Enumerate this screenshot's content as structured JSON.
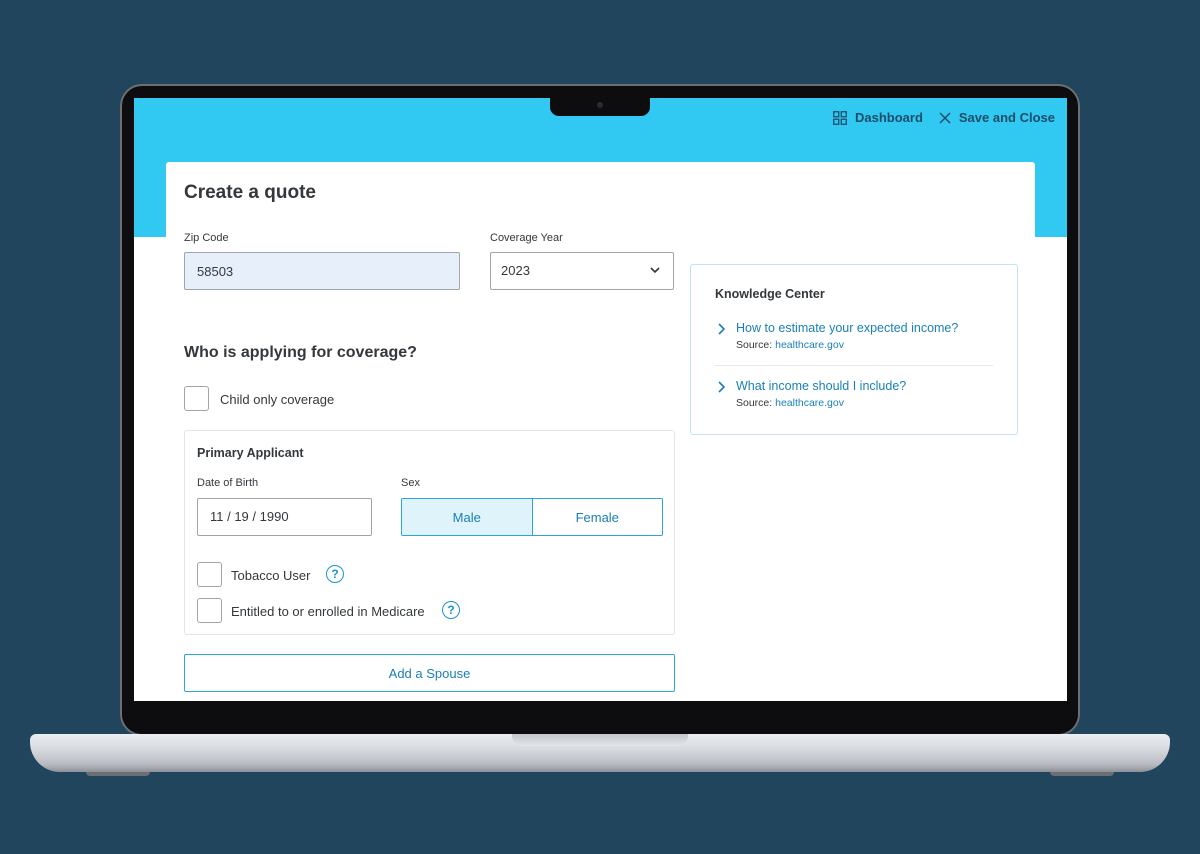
{
  "header": {
    "dashboard_label": "Dashboard",
    "save_close_label": "Save and Close"
  },
  "page": {
    "title": "Create a quote"
  },
  "zip": {
    "label": "Zip Code",
    "value": "58503"
  },
  "coverage_year": {
    "label": "Coverage Year",
    "selected": "2023"
  },
  "applying": {
    "title": "Who is applying for coverage?",
    "child_only_label": "Child only coverage"
  },
  "primary_applicant": {
    "title": "Primary Applicant",
    "dob_label": "Date of Birth",
    "dob_value": "11 / 19 / 1990",
    "sex_label": "Sex",
    "sex_options": [
      "Male",
      "Female"
    ],
    "sex_selected": "Male",
    "tobacco_label": "Tobacco User",
    "medicare_label": "Entitled to or enrolled in Medicare",
    "help_glyph": "?"
  },
  "add_spouse_label": "Add a Spouse",
  "knowledge_center": {
    "title": "Knowledge Center",
    "items": [
      {
        "link": "How to estimate your expected income?",
        "source_prefix": "Source:",
        "source": "healthcare.gov"
      },
      {
        "link": "What income should I include?",
        "source_prefix": "Source:",
        "source": "healthcare.gov"
      }
    ]
  },
  "colors": {
    "header_bg": "#31c9f1",
    "accent": "#1a7fb7",
    "page_bg": "#20455c"
  },
  "icons": {
    "dashboard": "grid-icon",
    "close": "close-icon",
    "dropdown": "chevron-down-icon",
    "link": "chevron-right-icon",
    "help": "help-circle-icon"
  }
}
